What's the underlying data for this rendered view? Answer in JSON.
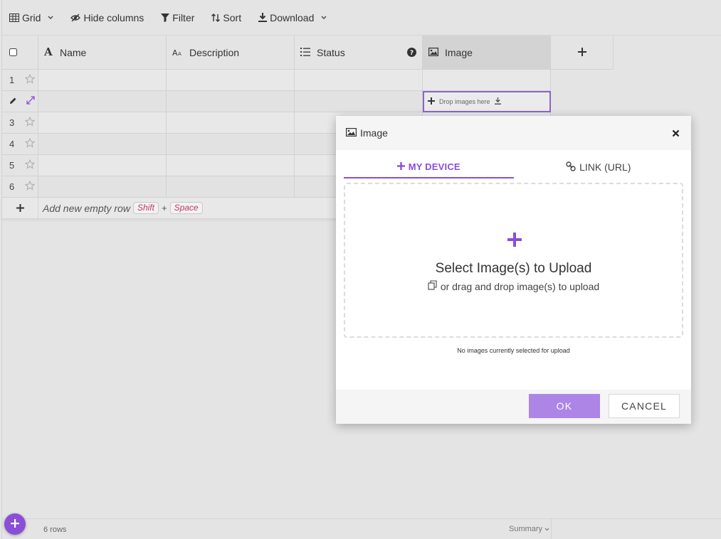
{
  "toolbar": {
    "grid_label": "Grid",
    "hide_columns_label": "Hide columns",
    "filter_label": "Filter",
    "sort_label": "Sort",
    "download_label": "Download"
  },
  "columns": [
    {
      "label": "Name",
      "icon": "text-a-icon"
    },
    {
      "label": "Description",
      "icon": "text-aa-icon"
    },
    {
      "label": "Status",
      "icon": "list-icon"
    },
    {
      "label": "Image",
      "icon": "image-icon"
    }
  ],
  "rows": [
    "1",
    "",
    "3",
    "4",
    "5",
    "6"
  ],
  "image_cell": {
    "drop_text": "Drop images here"
  },
  "add_row": {
    "label": "Add new empty row",
    "key1": "Shift",
    "plus": "+",
    "key2": "Space"
  },
  "footer": {
    "rows_count": "6 rows",
    "summary_label": "Summary"
  },
  "modal": {
    "title": "Image",
    "tab_device": "MY DEVICE",
    "tab_link": "LINK (URL)",
    "upload_title": "Select Image(s) to Upload",
    "upload_sub": "or drag and drop image(s) to upload",
    "note": "No images currently selected for upload",
    "ok_label": "OK",
    "cancel_label": "CANCEL"
  },
  "colors": {
    "accent": "#8a4fd6",
    "ok_button": "#ad85e6",
    "selected_border": "#8d64c8"
  }
}
